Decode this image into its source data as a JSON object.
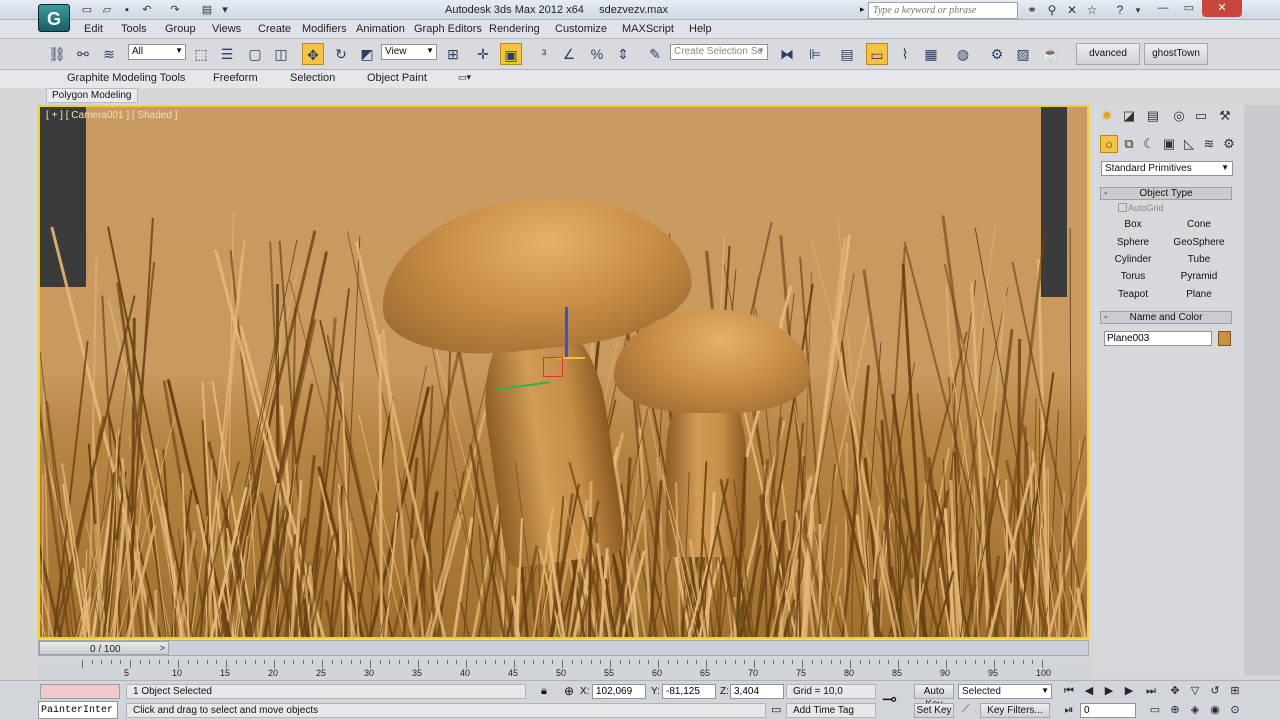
{
  "app": {
    "title": "Autodesk 3ds Max  2012 x64",
    "file_name": "sdezvezv.max",
    "logo_glyph": "G",
    "search_placeholder": "Type a keyword or phrase"
  },
  "menu": [
    "Edit",
    "Tools",
    "Group",
    "Views",
    "Create",
    "Modifiers",
    "Animation",
    "Graph Editors",
    "Rendering",
    "Customize",
    "MAXScript",
    "Help"
  ],
  "toolbar": {
    "filter_value": "All",
    "refcoord_value": "View",
    "selection_set_placeholder": "Create Selection Se",
    "named_buttons": [
      "dvanced Paint",
      "ghostTown"
    ],
    "icons": {
      "link": "link-icon",
      "unlink": "unlink-icon",
      "bind": "bind-space-warp-icon",
      "select": "select-object-icon",
      "select_by_name": "select-by-name-icon",
      "rect_region": "rectangle-region-icon",
      "window_crossing": "window-crossing-icon",
      "move": "move-icon",
      "rotate": "rotate-icon",
      "scale": "scale-icon",
      "pivot": "pivot-icon",
      "manipulate": "manipulate-icon",
      "snap3": "snap-3d-icon",
      "angle_snap": "angle-snap-icon",
      "percent_snap": "percent-snap-icon",
      "spinner_snap": "spinner-snap-icon",
      "edit_named": "edit-named-selection-icon",
      "mirror": "mirror-icon",
      "align": "align-icon",
      "layer": "layer-manager-icon",
      "graphite": "graphite-toggle-icon",
      "curve": "curve-editor-icon",
      "schematic": "schematic-view-icon",
      "material": "material-editor-icon",
      "render_setup": "render-setup-icon",
      "render_frame": "rendered-frame-icon",
      "render": "render-production-icon"
    }
  },
  "ribbon": {
    "tabs": [
      "Graphite Modeling Tools",
      "Freeform",
      "Selection",
      "Object Paint"
    ],
    "sub_tab": "Polygon Modeling"
  },
  "viewport": {
    "label": "[ + ] [ Camera001 ] [ Shaded ]",
    "active_border_color": "#f2d02a"
  },
  "command_panel": {
    "primitives_dropdown": "Standard Primitives",
    "object_type": {
      "title": "Object Type",
      "autogrid": "AutoGrid",
      "buttons": [
        "Box",
        "Cone",
        "Sphere",
        "GeoSphere",
        "Cylinder",
        "Tube",
        "Torus",
        "Pyramid",
        "Teapot",
        "Plane"
      ]
    },
    "name_and_color": {
      "title": "Name and Color",
      "name": "Plane003",
      "color": "#c9913c"
    }
  },
  "timeline": {
    "frame_display": "0 / 100",
    "ticks": [
      5,
      10,
      15,
      20,
      25,
      30,
      35,
      40,
      45,
      50,
      55,
      60,
      65,
      70,
      75,
      80,
      85,
      90,
      95,
      100
    ]
  },
  "status": {
    "listener_input": "PainterInter",
    "selected": "1 Object Selected",
    "prompt": "Click and drag to select and move objects",
    "x": "102,069",
    "y": "-81,125",
    "z": "3,404",
    "x_label": "X:",
    "y_label": "Y:",
    "z_label": "Z:",
    "grid": "Grid = 10,0",
    "add_time_tag": "Add Time Tag",
    "auto_key": "Auto Key",
    "set_key": "Set Key",
    "key_mode": "Selected",
    "key_filters": "Key Filters...",
    "current_frame": "0"
  }
}
